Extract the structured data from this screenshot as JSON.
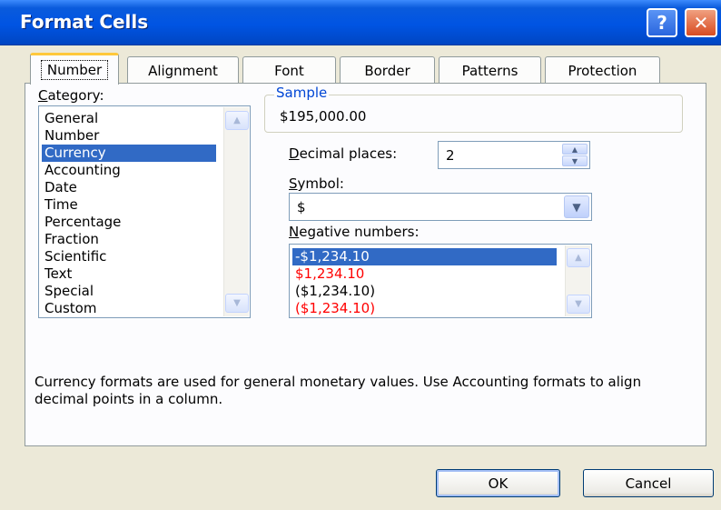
{
  "window": {
    "title": "Format Cells",
    "help_label": "?",
    "close_label": "✕"
  },
  "tabs": [
    {
      "label": "Number",
      "active": true
    },
    {
      "label": "Alignment",
      "active": false
    },
    {
      "label": "Font",
      "active": false
    },
    {
      "label": "Border",
      "active": false
    },
    {
      "label": "Patterns",
      "active": false
    },
    {
      "label": "Protection",
      "active": false
    }
  ],
  "category": {
    "label_underline": "C",
    "label_rest": "ategory:",
    "items": [
      "General",
      "Number",
      "Currency",
      "Accounting",
      "Date",
      "Time",
      "Percentage",
      "Fraction",
      "Scientific",
      "Text",
      "Special",
      "Custom"
    ],
    "selected": "Currency"
  },
  "sample": {
    "title": "Sample",
    "value": "$195,000.00"
  },
  "decimal_places": {
    "label_underline": "D",
    "label_rest": "ecimal places:",
    "value": "2"
  },
  "symbol": {
    "label_underline": "S",
    "label_rest": "ymbol:",
    "value": "$"
  },
  "negative_numbers": {
    "label_underline": "N",
    "label_rest": "egative numbers:",
    "items": [
      {
        "text": "-$1,234.10",
        "color": "#000000",
        "selected": true
      },
      {
        "text": "$1,234.10",
        "color": "#ff0000",
        "selected": false
      },
      {
        "text": "($1,234.10)",
        "color": "#000000",
        "selected": false
      },
      {
        "text": "($1,234.10)",
        "color": "#ff0000",
        "selected": false
      }
    ]
  },
  "description": "Currency formats are used for general monetary values.  Use Accounting formats to align decimal points in a column.",
  "buttons": {
    "ok": "OK",
    "cancel": "Cancel"
  },
  "colors": {
    "titlebar": "#0054e3",
    "selection": "#316ac5",
    "negative_red": "#ff0000",
    "group_title": "#0046d5"
  },
  "icons": {
    "scroll_up": "triangle-up-icon",
    "scroll_down": "triangle-down-icon",
    "spin_up": "triangle-up-icon",
    "spin_down": "triangle-down-icon",
    "dropdown": "chevron-down-icon"
  }
}
